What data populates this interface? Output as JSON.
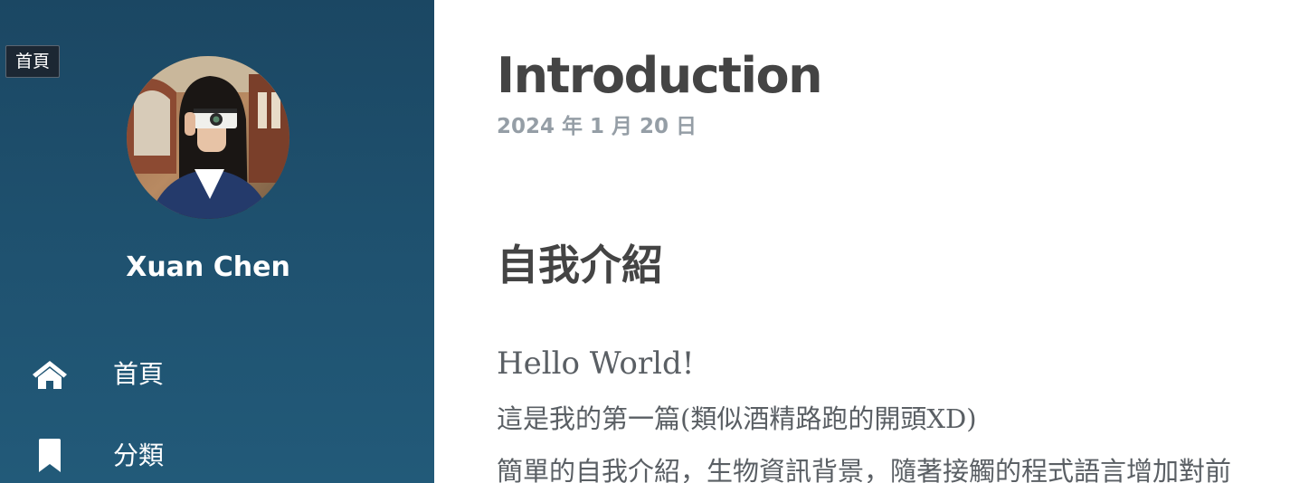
{
  "tooltip": {
    "text": "首頁"
  },
  "sidebar": {
    "author_name": "Xuan Chen",
    "nav": [
      {
        "label": "首頁",
        "icon": "home-icon"
      },
      {
        "label": "分類",
        "icon": "bookmark-icon"
      }
    ]
  },
  "post": {
    "title": "Introduction",
    "date": "2024 年 1 月 20 日",
    "section_heading": "自我介紹",
    "paragraphs": [
      "Hello World!",
      "這是我的第一篇(類似酒精路跑的開頭XD)",
      "簡單的自我介紹，生物資訊背景，隨著接觸的程式語言增加對前"
    ]
  },
  "colors": {
    "sidebar_bg": "#1f5270",
    "title_text": "#444444",
    "date_text": "#959ea6",
    "body_text": "#5a5f64"
  }
}
